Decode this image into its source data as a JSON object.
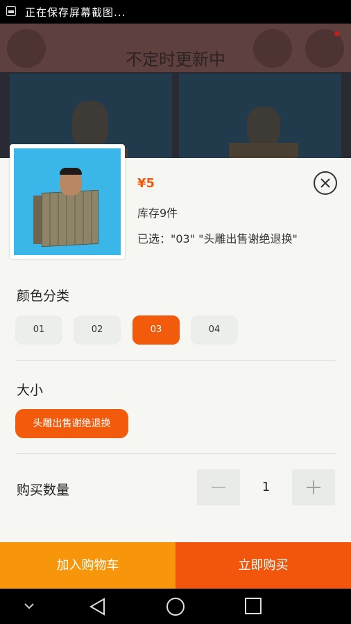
{
  "status_bar": {
    "text": "正在保存屏幕截图..."
  },
  "background_app": {
    "header_title": "不定时更新中"
  },
  "product": {
    "price": "¥5",
    "stock": "库存9件",
    "selected": "已选：\"03\" \"头雕出售谢绝退换\""
  },
  "color_section": {
    "title": "颜色分类",
    "options": [
      "01",
      "02",
      "03",
      "04"
    ],
    "selected": "03"
  },
  "size_section": {
    "title": "大小",
    "option": "头雕出售谢绝退换"
  },
  "quantity": {
    "label": "购买数量",
    "value": "1"
  },
  "actions": {
    "add_to_cart": "加入购物车",
    "buy_now": "立即购买"
  },
  "colors": {
    "accent": "#f25a0c",
    "cart": "#f7960b"
  },
  "icons": [
    "close-icon",
    "minus-icon",
    "plus-icon",
    "back-icon",
    "home-icon",
    "recents-icon",
    "chevron-down-icon"
  ]
}
